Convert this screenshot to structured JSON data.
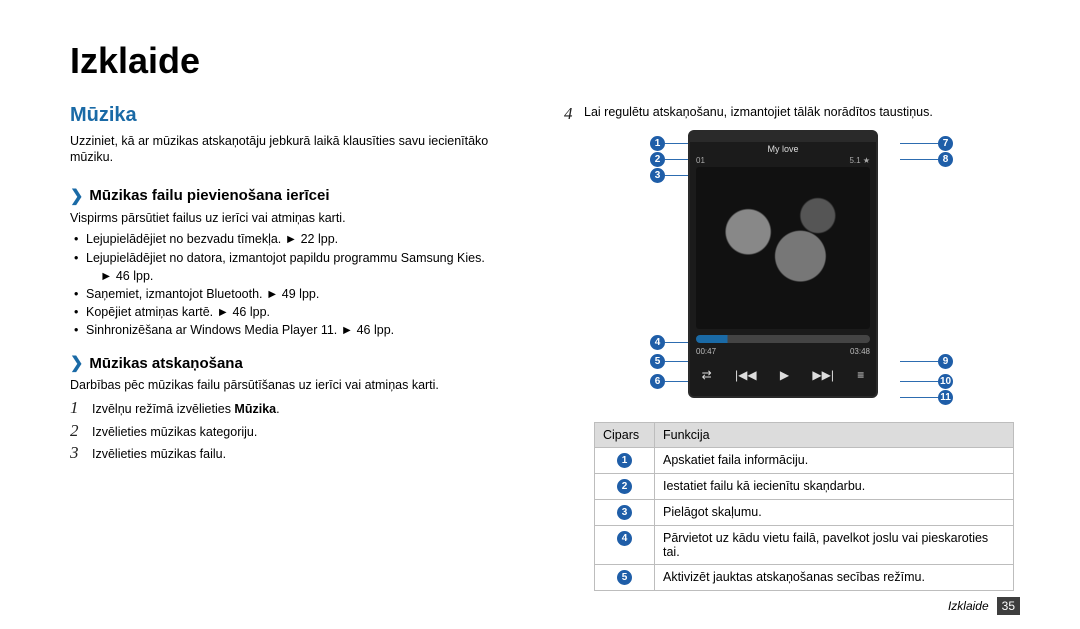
{
  "title": "Izklaide",
  "section": {
    "heading": "Mūzika",
    "intro": "Uzziniet, kā ar mūzikas atskaņotāju jebkurā laikā klausīties savu iecienītāko mūziku."
  },
  "sub1": {
    "title": "Mūzikas failu pievienošana ierīcei",
    "lead": "Vispirms pārsūtiet failus uz ierīci vai atmiņas karti.",
    "bullets": [
      "Lejupielādējiet no bezvadu tīmekļa. ► 22 lpp.",
      "Lejupielādējiet no datora, izmantojot papildu programmu Samsung Kies.",
      "► 46 lpp.",
      "Saņemiet, izmantojot Bluetooth. ► 49 lpp.",
      "Kopējiet atmiņas kartē. ► 46 lpp.",
      "Sinhronizēšana ar Windows Media Player 11. ► 46 lpp."
    ]
  },
  "sub2": {
    "title": "Mūzikas atskaņošana",
    "lead": "Darbības pēc mūzikas failu pārsūtīšanas uz ierīci vai atmiņas karti.",
    "steps": [
      {
        "n": "1",
        "pre": "Izvēlņu režīmā izvēlieties ",
        "bold": "Mūzika",
        "post": "."
      },
      {
        "n": "2",
        "pre": "Izvēlieties mūzikas kategoriju."
      },
      {
        "n": "3",
        "pre": "Izvēlieties mūzikas failu."
      }
    ]
  },
  "rightStep": {
    "n": "4",
    "text": "Lai regulētu atskaņošanu, izmantojiet tālāk norādītos taustiņus."
  },
  "phone": {
    "title": "My love",
    "left": "01",
    "right": "5.1",
    "t1": "00:47",
    "t2": "03:48",
    "controls": [
      "⇄",
      "|◀◀",
      "▶",
      "▶▶|",
      "≡"
    ]
  },
  "table": {
    "headers": [
      "Cipars",
      "Funkcija"
    ],
    "rows": [
      {
        "n": "1",
        "f": "Apskatiet faila informāciju."
      },
      {
        "n": "2",
        "f": "Iestatiet failu kā iecienītu skaņdarbu."
      },
      {
        "n": "3",
        "f": "Pielāgot skaļumu."
      },
      {
        "n": "4",
        "f": "Pārvietot uz kādu vietu failā, pavelkot joslu vai pieskaroties tai."
      },
      {
        "n": "5",
        "f": "Aktivizēt jauktas atskaņošanas secības režīmu."
      }
    ]
  },
  "footer": {
    "section": "Izklaide",
    "page": "35"
  }
}
